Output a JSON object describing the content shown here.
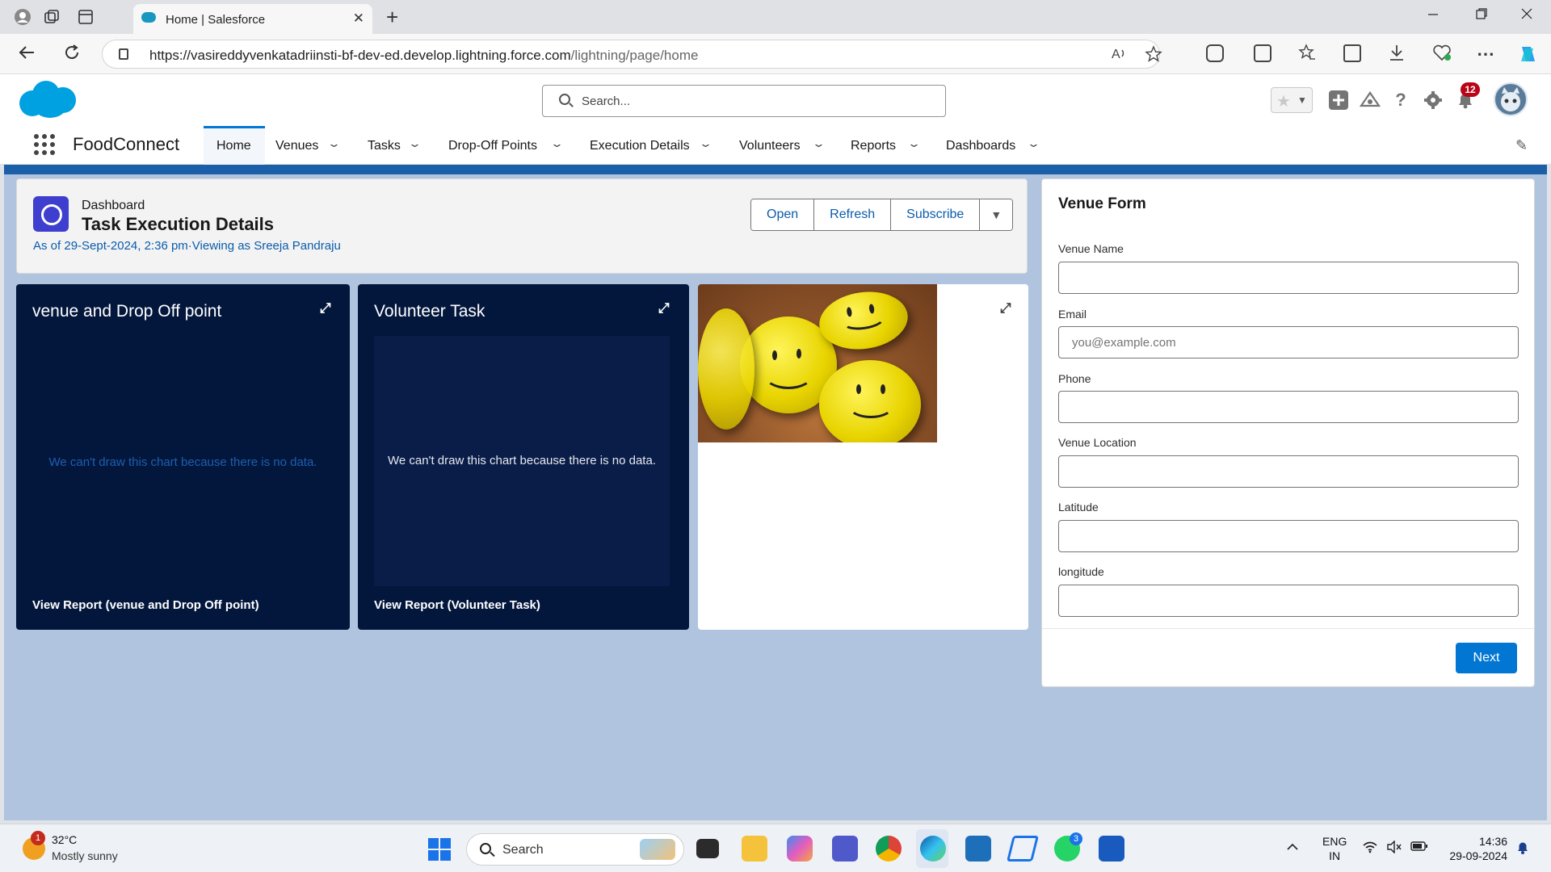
{
  "browser": {
    "tab_title": "Home | Salesforce",
    "url_host": "https://vasireddyvenkatadriinsti-bf-dev-ed.develop.lightning.force.com",
    "url_path": "/lightning/page/home",
    "new_tab_glyph": "+",
    "close_glyph": "✕"
  },
  "header": {
    "search_placeholder": "Search...",
    "notification_count": "12"
  },
  "nav": {
    "app_name": "FoodConnect",
    "items": [
      {
        "label": "Home",
        "active": true
      },
      {
        "label": "Venues"
      },
      {
        "label": "Tasks"
      },
      {
        "label": "Drop-Off Points"
      },
      {
        "label": "Execution Details"
      },
      {
        "label": "Volunteers"
      },
      {
        "label": "Reports"
      },
      {
        "label": "Dashboards"
      }
    ]
  },
  "dashboard": {
    "kicker": "Dashboard",
    "title": "Task Execution Details",
    "subtitle": "As of 29-Sept-2024, 2:36 pm·Viewing as Sreeja Pandraju",
    "buttons": {
      "open": "Open",
      "refresh": "Refresh",
      "subscribe": "Subscribe"
    }
  },
  "widgets": [
    {
      "title": "venue and Drop Off point",
      "empty_message": "We can't draw this chart because there is no data.",
      "link": "View Report (venue and Drop Off point)"
    },
    {
      "title": "Volunteer Task",
      "empty_message": "We can't draw this chart because there is no data.",
      "link": "View Report (Volunteer Task)"
    }
  ],
  "form": {
    "title": "Venue Form",
    "fields": [
      {
        "label": "Venue Name",
        "value": "",
        "placeholder": ""
      },
      {
        "label": "Email",
        "value": "",
        "placeholder": "you@example.com"
      },
      {
        "label": "Phone",
        "value": "",
        "placeholder": ""
      },
      {
        "label": "Venue Location",
        "value": "",
        "placeholder": ""
      },
      {
        "label": "Latitude",
        "value": "",
        "placeholder": ""
      },
      {
        "label": "longitude",
        "value": "",
        "placeholder": ""
      }
    ],
    "next_label": "Next"
  },
  "taskbar": {
    "weather_badge": "1",
    "temperature": "32°C",
    "condition": "Mostly sunny",
    "search_label": "Search",
    "whatsapp_badge": "3",
    "lang_1": "ENG",
    "lang_2": "IN",
    "time": "14:36",
    "date": "29-09-2024"
  },
  "colors": {
    "brand_blue": "#0176d3",
    "dark_widget": "#03173d",
    "page_band": "#1b5fa8",
    "page_background": "#b0c4df",
    "link_blue": "#0b5cab"
  }
}
